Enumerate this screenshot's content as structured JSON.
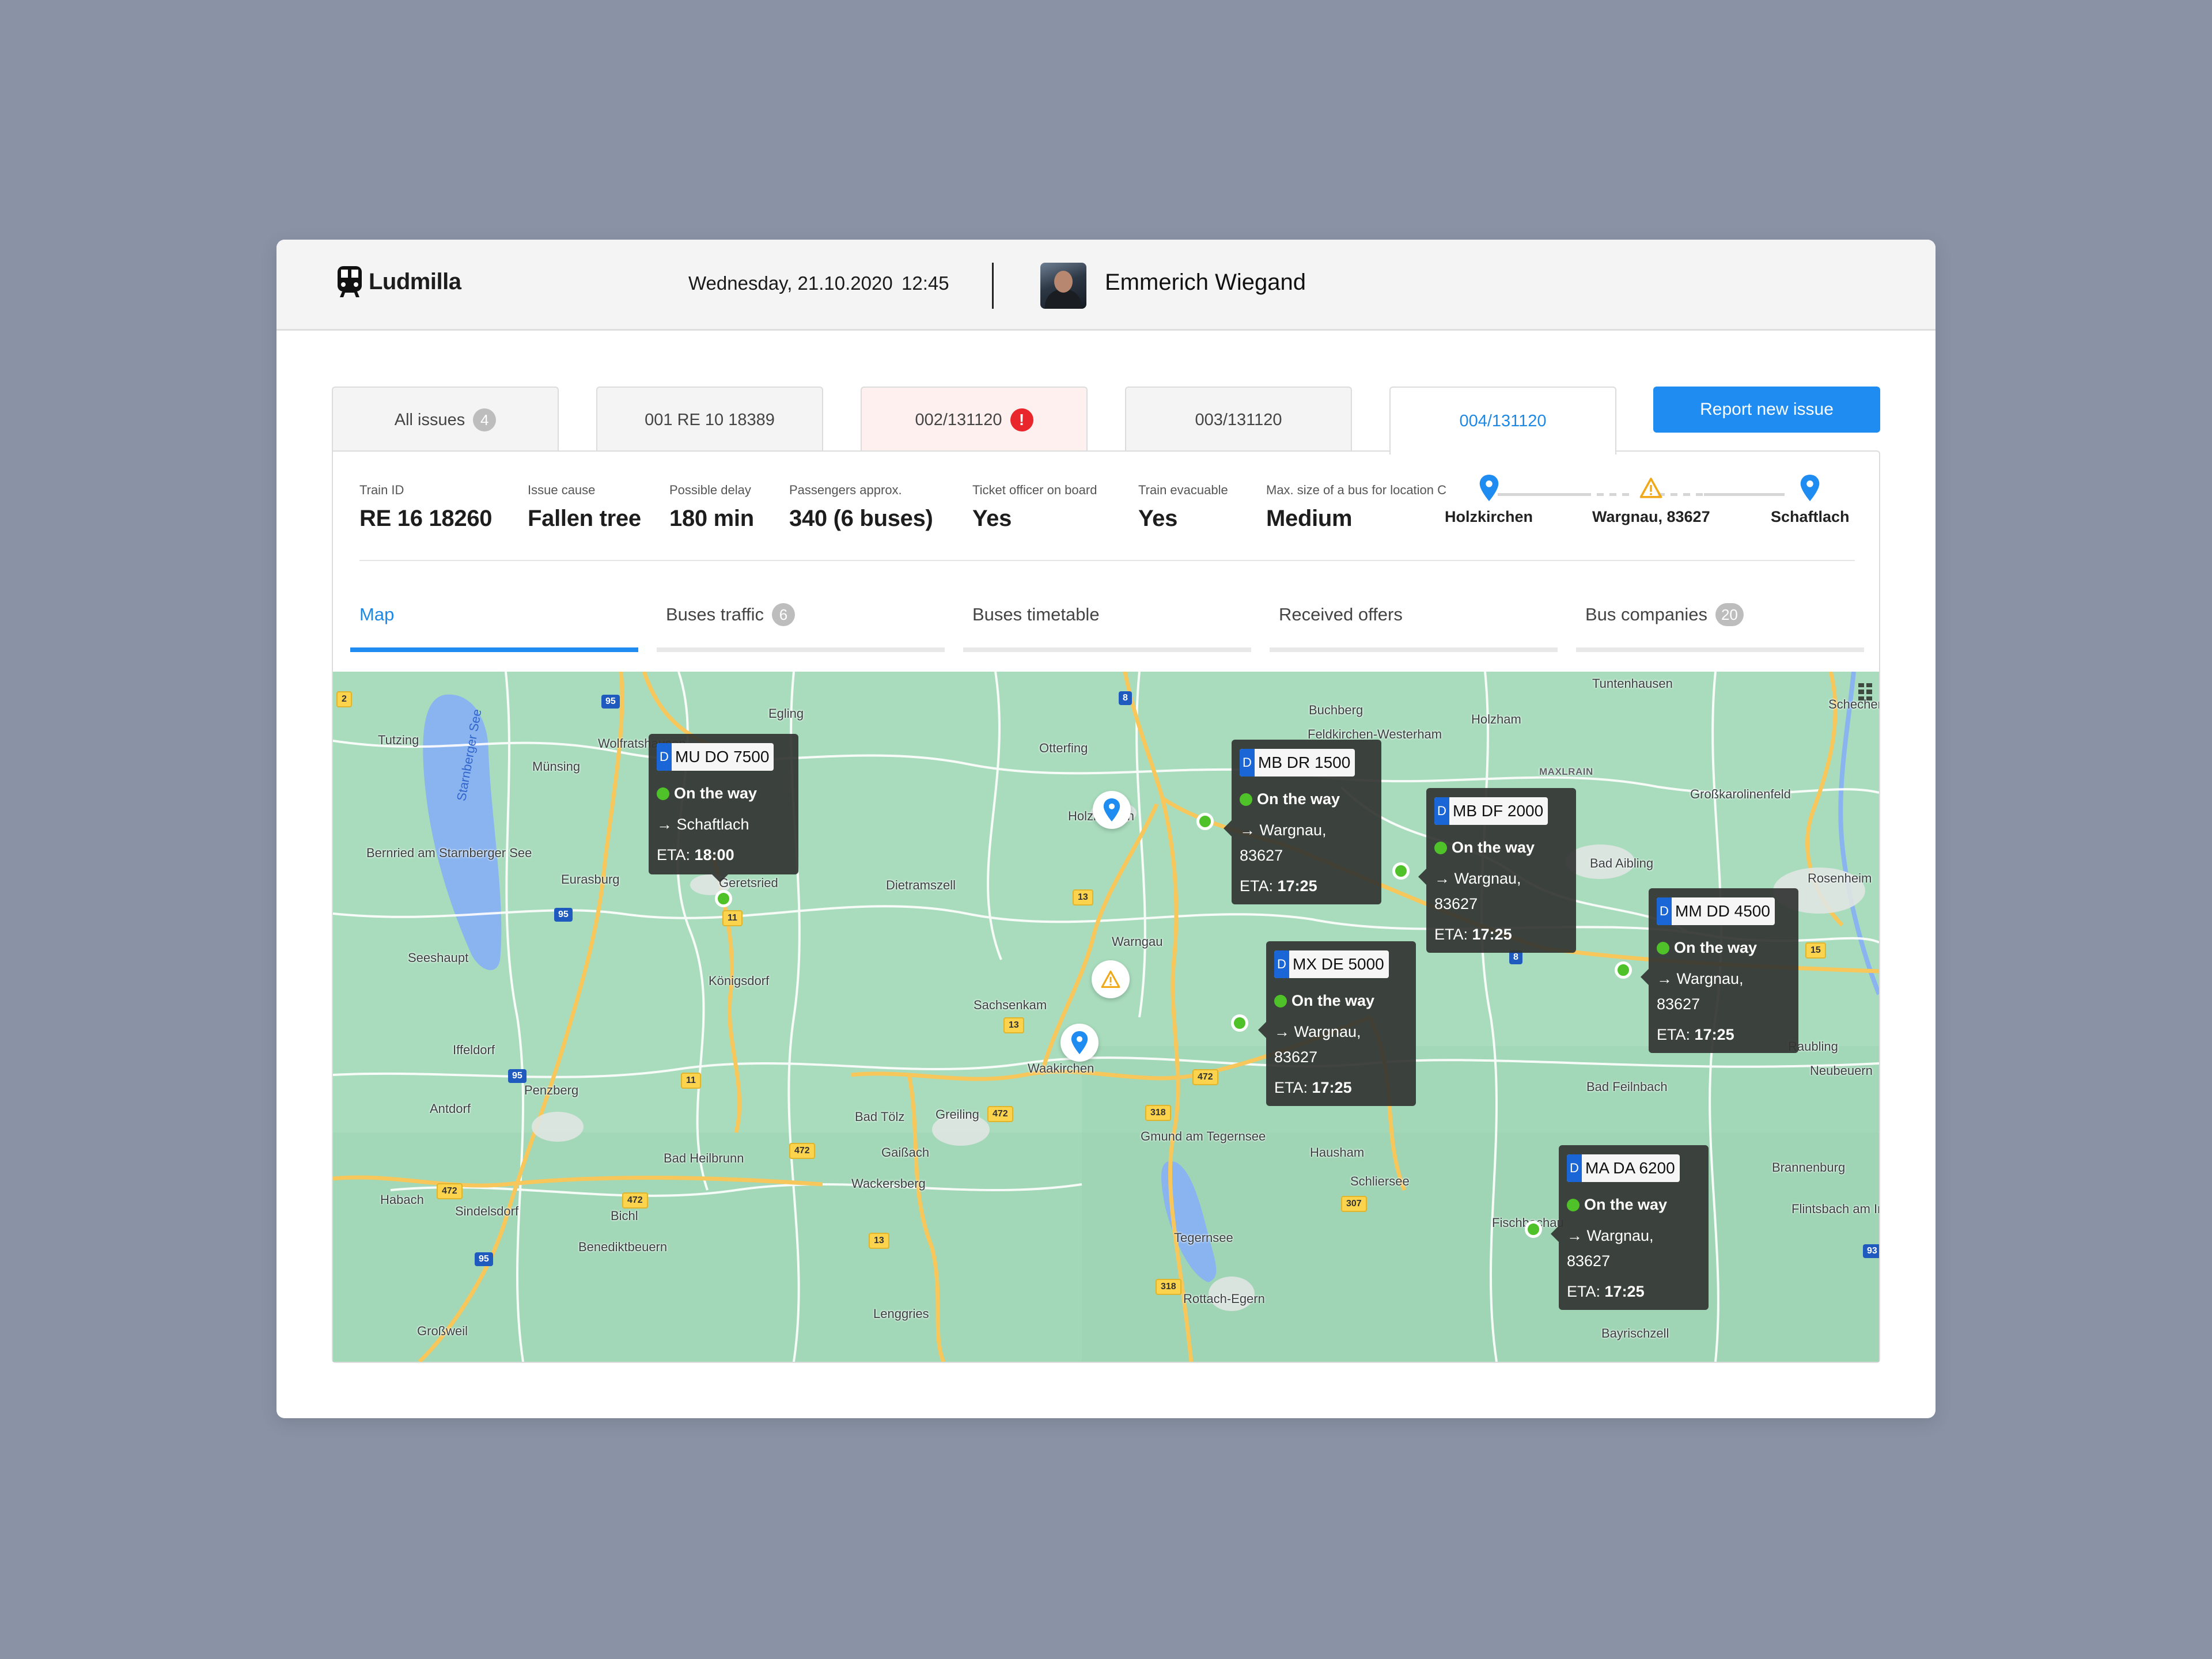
{
  "app": {
    "name": "Ludmilla",
    "logo_icon": "train-icon"
  },
  "header": {
    "date": "Wednesday, 21.10.2020",
    "time": "12:45",
    "user_name": "Emmerich Wiegand"
  },
  "issue_tabs": [
    {
      "label": "All issues",
      "badge": "4",
      "state": "normal"
    },
    {
      "label": "001 RE 10 18389",
      "state": "normal"
    },
    {
      "label": "002/131120",
      "state": "alert",
      "alert_icon": "!"
    },
    {
      "label": "003/131120",
      "state": "normal"
    },
    {
      "label": "004/131120",
      "state": "active"
    }
  ],
  "report_button": "Report new issue",
  "issue": {
    "fields": [
      {
        "label": "Train ID",
        "value": "RE 16 18260"
      },
      {
        "label": "Issue cause",
        "value": "Fallen tree"
      },
      {
        "label": "Possible delay",
        "value": "180 min"
      },
      {
        "label": "Passengers approx.",
        "value": "340 (6 buses)"
      },
      {
        "label": "Ticket officer on board",
        "value": "Yes"
      },
      {
        "label": "Train evacuable",
        "value": "Yes"
      },
      {
        "label": "Max. size of a bus for location C",
        "value": "Medium"
      }
    ],
    "route": [
      {
        "name": "Holzkirchen",
        "icon": "location-pin-icon"
      },
      {
        "name": "Wargnau, 83627",
        "icon": "warning-icon"
      },
      {
        "name": "Schaftlach",
        "icon": "location-pin-icon"
      }
    ]
  },
  "subtabs": [
    {
      "label": "Map",
      "active": true
    },
    {
      "label": "Buses traffic",
      "badge": "6"
    },
    {
      "label": "Buses timetable"
    },
    {
      "label": "Received offers"
    },
    {
      "label": "Bus companies",
      "badge": "20"
    }
  ],
  "map": {
    "places": [
      "Tutzing",
      "Münsing",
      "Wolfratshausen",
      "Egling",
      "Otterfing",
      "Holzkirchen",
      "Buchberg",
      "Feldkirchen-Westerham",
      "Holzham",
      "Tuntenhausen",
      "Schechen",
      "MAXLRAIN",
      "Großkarolinenfeld",
      "Bad Aibling",
      "Rosenheim",
      "Bernried am Starnberger See",
      "Eurasburg",
      "Geretsried",
      "Dietramszell",
      "Warngau",
      "Seeshaupt",
      "Königsdorf",
      "Sachsenkam",
      "Waakirchen",
      "Iffeldorf",
      "Penzberg",
      "Antdorf",
      "Bad Tölz",
      "Greiling",
      "Bad Heilbrunn",
      "Gaißach",
      "Gmund am Tegernsee",
      "Hausham",
      "Wackersberg",
      "Habach",
      "Sindelsdorf",
      "Bichl",
      "Schliersee",
      "Benediktbeuern",
      "Tegernsee",
      "Lenggries",
      "Rottach-Egern",
      "Großweil",
      "Bad Feilnbach",
      "Brannenburg",
      "Flintsbach am Inn",
      "Bayrischzell",
      "Fischbachau",
      "Neubeuern",
      "Raubling",
      "Starnberger See"
    ],
    "buses": [
      {
        "plate": "MU DO 7500",
        "country": "D",
        "status": "On the way",
        "destination": "→ Schaftlach",
        "destination_zip": "",
        "eta_label": "ETA:",
        "eta": "18:00"
      },
      {
        "plate": "MB DR 1500",
        "country": "D",
        "status": "On the way",
        "destination": "→ Wargnau,",
        "destination_zip": "83627",
        "eta_label": "ETA:",
        "eta": "17:25"
      },
      {
        "plate": "MB DF 2000",
        "country": "D",
        "status": "On the way",
        "destination": "→ Wargnau,",
        "destination_zip": "83627",
        "eta_label": "ETA:",
        "eta": "17:25"
      },
      {
        "plate": "MX DE 5000",
        "country": "D",
        "status": "On the way",
        "destination": "→ Wargnau,",
        "destination_zip": "83627",
        "eta_label": "ETA:",
        "eta": "17:25"
      },
      {
        "plate": "MM DD 4500",
        "country": "D",
        "status": "On the way",
        "destination": "→ Wargnau,",
        "destination_zip": "83627",
        "eta_label": "ETA:",
        "eta": "17:25"
      },
      {
        "plate": "MA DA 6200",
        "country": "D",
        "status": "On the way",
        "destination": "→ Wargnau,",
        "destination_zip": "83627",
        "eta_label": "ETA:",
        "eta": "17:25"
      }
    ],
    "road_shields": [
      "2",
      "95",
      "8",
      "13",
      "11",
      "318",
      "472",
      "307",
      "15",
      "93"
    ]
  },
  "colors": {
    "accent": "#1e8cf0",
    "alert": "#e8262b",
    "warning": "#f0a818",
    "status_ok": "#4fc22a",
    "map_bg": "#a9dcbd"
  }
}
